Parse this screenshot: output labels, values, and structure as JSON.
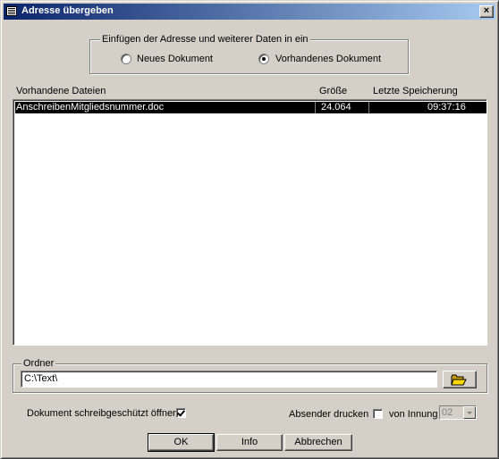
{
  "window": {
    "title": "Adresse übergeben",
    "close_glyph": "×"
  },
  "insert_group": {
    "label": "Einfügen der Adresse und weiterer Daten in ein",
    "options": [
      {
        "label": "Neues Dokument",
        "selected": false
      },
      {
        "label": "Vorhandenes Dokument",
        "selected": true
      }
    ]
  },
  "files": {
    "headers": {
      "name": "Vorhandene Dateien",
      "size": "Größe",
      "saved": "Letzte Speicherung"
    },
    "rows": [
      {
        "name": "AnschreibenMitgliedsnummer.doc",
        "size": "24.064",
        "saved": "09:37:16",
        "selected": true
      }
    ]
  },
  "folder": {
    "label": "Ordner",
    "value": "C:\\Text\\",
    "browse_icon": "open-folder-icon"
  },
  "options": {
    "readonly_label": "Dokument schreibgeschützt öffnen",
    "readonly_checked": true,
    "sender_label": "Absender drucken",
    "sender_checked": false,
    "guild_label": "von Innung",
    "guild_value": "02"
  },
  "buttons": {
    "ok": "OK",
    "info": "Info",
    "cancel": "Abbrechen"
  },
  "colors": {
    "face": "#d4d0c8",
    "title_start": "#0a246a",
    "title_end": "#a6caf0",
    "selection": "#000000"
  }
}
